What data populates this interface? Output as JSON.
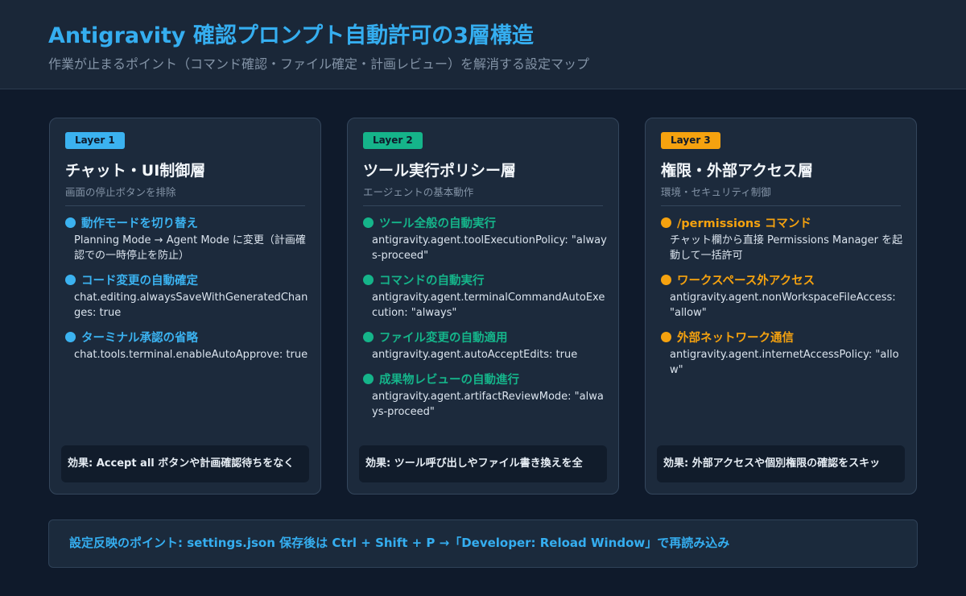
{
  "header": {
    "title": "Antigravity 確認プロンプト自動許可の3層構造",
    "subtitle": "作業が止まるポイント（コマンド確認・ファイル確定・計画レビュー）を解消する設定マップ"
  },
  "colors": {
    "layer1": "#3bb2f0",
    "layer2": "#15b48a",
    "layer3": "#f5a20f"
  },
  "layers": [
    {
      "badge": "Layer 1",
      "title": "チャット・UI制御層",
      "subtitle": "画面の停止ボタンを排除",
      "items": [
        {
          "title": "動作モードを切り替え",
          "desc": "Planning Mode → Agent Mode に変更（計画確認での一時停止を防止）"
        },
        {
          "title": "コード変更の自動確定",
          "desc": "chat.editing.alwaysSaveWithGeneratedChanges: true"
        },
        {
          "title": "ターミナル承認の省略",
          "desc": "chat.tools.terminal.enableAutoApprove: true"
        }
      ],
      "effect": "効果: Accept all ボタンや計画確認待ちをなく"
    },
    {
      "badge": "Layer 2",
      "title": "ツール実行ポリシー層",
      "subtitle": "エージェントの基本動作",
      "items": [
        {
          "title": "ツール全般の自動実行",
          "desc": "antigravity.agent.toolExecutionPolicy: \"always-proceed\""
        },
        {
          "title": "コマンドの自動実行",
          "desc": "antigravity.agent.terminalCommandAutoExecution: \"always\""
        },
        {
          "title": "ファイル変更の自動適用",
          "desc": "antigravity.agent.autoAcceptEdits: true"
        },
        {
          "title": "成果物レビューの自動進行",
          "desc": "antigravity.agent.artifactReviewMode: \"always-proceed\""
        }
      ],
      "effect": "効果: ツール呼び出しやファイル書き換えを全"
    },
    {
      "badge": "Layer 3",
      "title": "権限・外部アクセス層",
      "subtitle": "環境・セキュリティ制御",
      "items": [
        {
          "title": "/permissions コマンド",
          "desc": "チャット欄から直接 Permissions Manager を起動して一括許可"
        },
        {
          "title": "ワークスペース外アクセス",
          "desc": "antigravity.agent.nonWorkspaceFileAccess: \"allow\""
        },
        {
          "title": "外部ネットワーク通信",
          "desc": "antigravity.agent.internetAccessPolicy: \"allow\""
        }
      ],
      "effect": "効果: 外部アクセスや個別権限の確認をスキッ"
    }
  ],
  "footer": {
    "text": "設定反映のポイント: settings.json 保存後は Ctrl + Shift + P →「Developer: Reload Window」で再読み込み"
  }
}
